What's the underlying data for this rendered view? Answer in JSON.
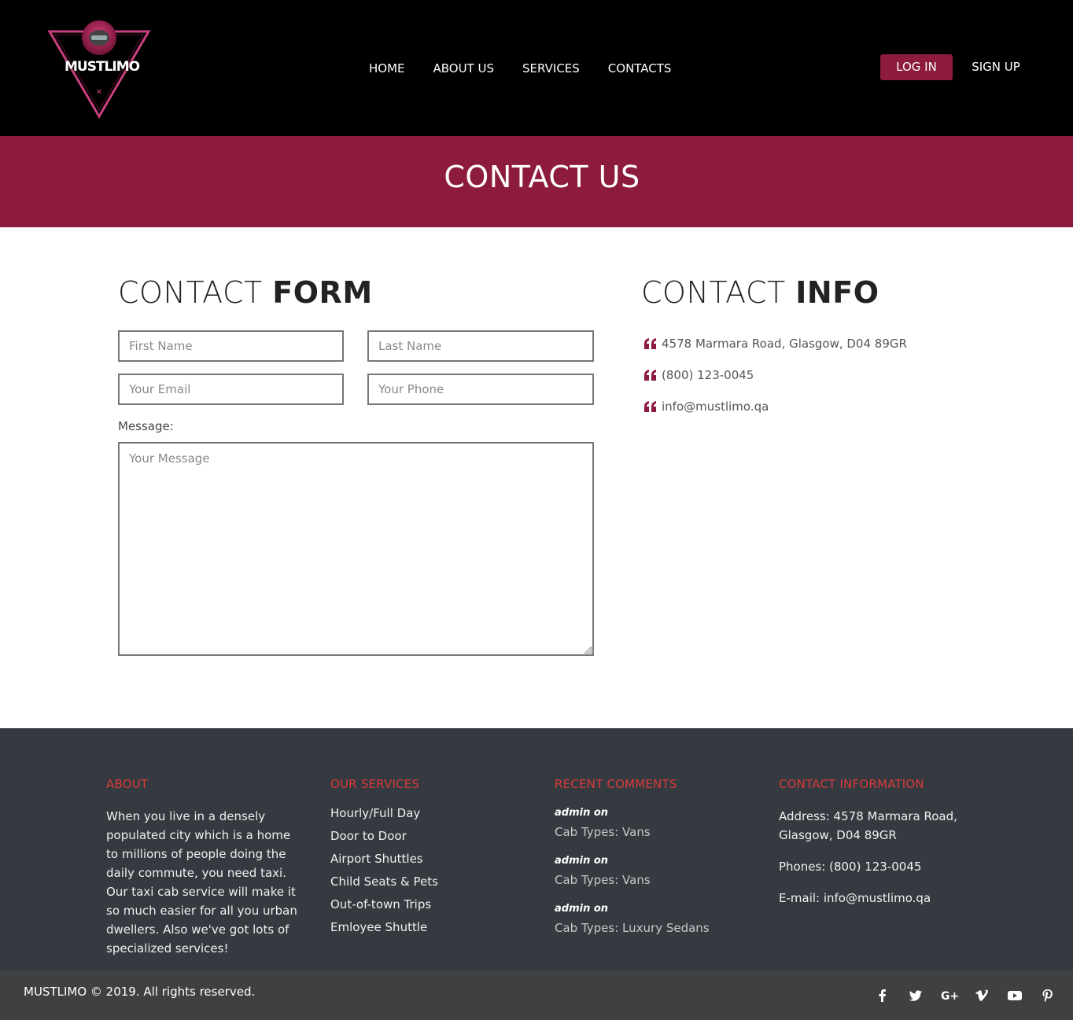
{
  "brand": {
    "name": "MUSTLIMO",
    "accent": "#8d1b3d"
  },
  "nav": {
    "items": [
      {
        "label": "HOME"
      },
      {
        "label": "ABOUT US"
      },
      {
        "label": "SERVICES"
      },
      {
        "label": "CONTACTS"
      }
    ],
    "login_label": "LOG IN",
    "signup_label": "SIGN UP"
  },
  "banner": {
    "title": "CONTACT US"
  },
  "contact_form": {
    "title_light": "CONTACT ",
    "title_bold": "FORM",
    "first_name_placeholder": "First Name",
    "last_name_placeholder": "Last Name",
    "email_placeholder": "Your Email",
    "phone_placeholder": "Your Phone",
    "message_label": "Message:",
    "message_placeholder": "Your Message"
  },
  "contact_info": {
    "title_light": "CONTACT ",
    "title_bold": "INFO",
    "address": "4578 Marmara Road, Glasgow, D04 89GR",
    "phone": "(800) 123-0045",
    "email": "info@mustlimo.qa",
    "icon": "quote-icon"
  },
  "footer": {
    "about": {
      "heading": "ABOUT",
      "text": "When you live in a densely populated city which is a home to millions of people doing the daily commute, you need taxi. Our taxi cab service will make it so much easier for all you urban dwellers. Also we've got lots of specialized services!"
    },
    "services": {
      "heading": "OUR SERVICES",
      "items": [
        "Hourly/Full Day",
        "Door to Door",
        "Airport Shuttles",
        "Child Seats & Pets",
        "Out-of-town Trips",
        "Emloyee Shuttle"
      ]
    },
    "comments": {
      "heading": "RECENT COMMENTS",
      "items": [
        {
          "who": "admin on",
          "text": "Cab Types: Vans"
        },
        {
          "who": "admin on",
          "text": "Cab Types: Vans"
        },
        {
          "who": "admin on",
          "text": "Cab Types: Luxury Sedans"
        }
      ]
    },
    "contact": {
      "heading": "CONTACT INFORMATION",
      "address": "Address: 4578 Marmara Road, Glasgow, D04 89GR",
      "phones": "Phones: (800) 123-0045",
      "email": "E-mail: info@mustlimo.qa"
    },
    "copyright": "MUSTLIMO © 2019. All rights reserved.",
    "social": [
      "facebook-icon",
      "twitter-icon",
      "google-plus-icon",
      "vimeo-icon",
      "youtube-icon",
      "pinterest-icon"
    ],
    "heading_color": "#d93a3a"
  }
}
